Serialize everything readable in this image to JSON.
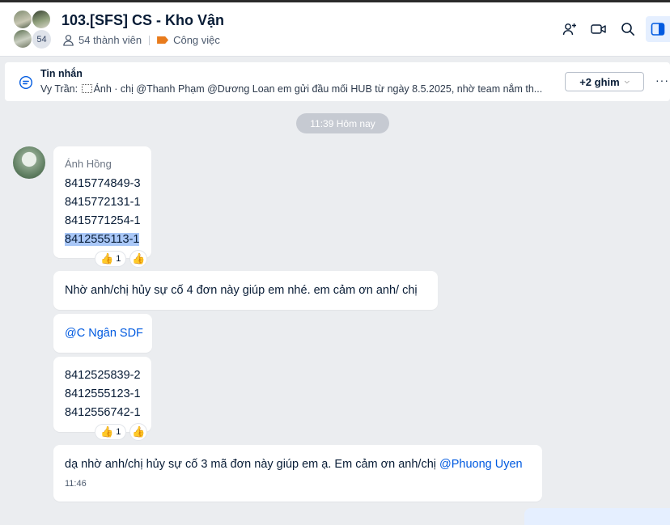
{
  "header": {
    "title": "103.[SFS] CS - Kho Vận",
    "member_count_badge": "54",
    "members_text": "54 thành viên",
    "label_text": "Công việc",
    "label_color": "#e87b1c"
  },
  "pinned": {
    "title": "Tin nhắn",
    "sender": "Vy Trần:",
    "text": "Ảnh · chị @Thanh Phạm @Dương Loan em gửi đầu mối HUB từ ngày 8.5.2025, nhờ team nắm th...",
    "pins_button": "+2 ghim",
    "more": "···"
  },
  "divider": {
    "time": "11:39 Hôm nay"
  },
  "messages": {
    "m1": {
      "sender": "Ánh Hồng",
      "lines": [
        "8415774849-3",
        "8415772131-1",
        "8415771254-1",
        "8412555113-1"
      ],
      "reaction_count": "1"
    },
    "m2": {
      "text": "Nhờ anh/chị hủy sự cố 4 đơn này giúp em nhé. em cảm ơn anh/ chị"
    },
    "m3": {
      "mention": "@C Ngân SDF"
    },
    "m4": {
      "lines": [
        "8412525839-2",
        "8412555123-1",
        "8412556742-1"
      ],
      "reaction_count": "1"
    },
    "m5": {
      "text": "dạ nhờ anh/chị hủy sự cố 3 mã đơn này giúp em ạ. Em cảm ơn anh/chị ",
      "mention": "@Phuong Uyen",
      "time": "11:46"
    }
  },
  "icons": {
    "add_member": "add-member-icon",
    "video_call": "video-call-icon",
    "search": "search-icon",
    "sidebar_toggle": "sidebar-toggle-icon",
    "reaction": "thumbs-up-icon"
  },
  "colors": {
    "accent": "#005ae0",
    "highlight": "#a9c7f7",
    "chat_bg": "#ebedf0"
  }
}
